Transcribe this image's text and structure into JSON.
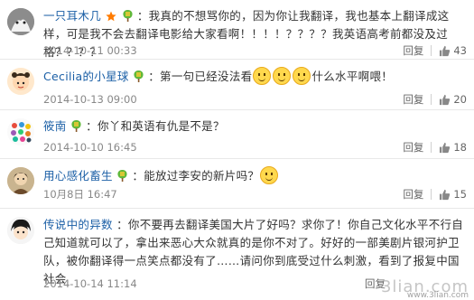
{
  "colors": {
    "link": "#1b5fa6",
    "meta": "#888888",
    "text": "#333333",
    "emoji": "#ffd84d"
  },
  "comments": [
    {
      "username": "一只耳木几",
      "badges": [
        "star-icon",
        "tree-badge-icon"
      ],
      "text": "我真的不想骂你的，因为你让我翻译，我也基本上翻译成这样，可是我不会去翻译电影给大家看啊！！！！？？？？我英语高考前都没及过格？？？？",
      "date": "2014-10-11 00:33",
      "reply_label": "回复",
      "likes": "43"
    },
    {
      "username": "Cecilia的小星球",
      "badges": [
        "tree-badge-icon"
      ],
      "text_before": "第一句已经没法看",
      "emojis": [
        "smile-emoji-icon",
        "smile-emoji-icon",
        "smile-emoji-icon"
      ],
      "text_after": "什么水平啊喂！",
      "date": "2014-10-13 09:00",
      "reply_label": "回复",
      "likes": "20"
    },
    {
      "username": "筱南",
      "badges": [
        "tree-badge-icon"
      ],
      "text": "你丫和英语有仇是不是？",
      "date": "2014-10-10 16:45",
      "reply_label": "回复",
      "likes": "18"
    },
    {
      "username": "用心感化畜生",
      "badges": [
        "tree-badge-icon"
      ],
      "text": "能放过李安的新片吗？",
      "emojis": [
        "smile-emoji-icon"
      ],
      "date": "10月8日 16:47",
      "reply_label": "回复",
      "likes": "15"
    },
    {
      "username": "传说中的异数",
      "badges": [],
      "text": "你不要再去翻译美国大片了好吗？求你了！你自己文化水平不行自己知道就可以了，拿出来恶心大众就真的是你不对了。好好的一部美剧片银河护卫队，被你翻译得一点笑点都没有了……请问你到底受过什么刺激，看到了报复中国社会",
      "date": "2014-10-14 11:14",
      "reply_label": "回复",
      "likes": "?"
    }
  ],
  "watermark": {
    "text": "3lian.com",
    "small": "www.3lian.com"
  }
}
